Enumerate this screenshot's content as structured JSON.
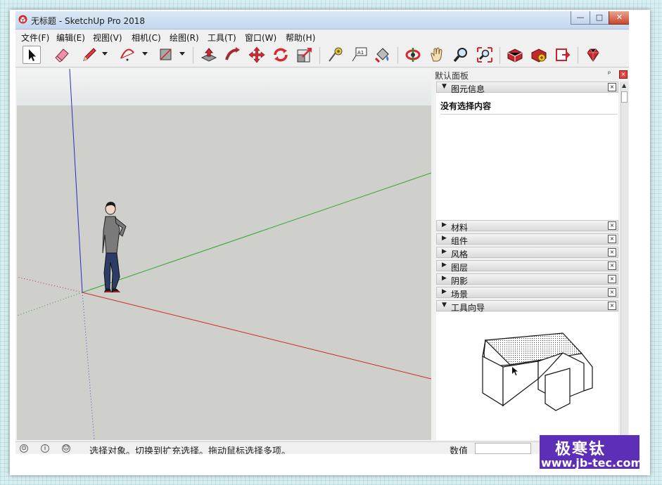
{
  "window": {
    "title": "无标题 - SketchUp Pro 2018",
    "controls": {
      "minimize": "—",
      "maximize": "□",
      "close": "✕"
    }
  },
  "menu": [
    "文件(F)",
    "编辑(E)",
    "视图(V)",
    "相机(C)",
    "绘图(R)",
    "工具(T)",
    "窗口(W)",
    "帮助(H)"
  ],
  "toolbar": {
    "tools": [
      {
        "name": "select-tool-icon"
      },
      {
        "name": "eraser-tool-icon"
      },
      {
        "name": "pencil-line-tool-icon"
      },
      {
        "name": "arc-tool-icon"
      },
      {
        "name": "rectangle-tool-icon"
      },
      {
        "name": "push-pull-tool-icon"
      },
      {
        "name": "follow-me-tool-icon"
      },
      {
        "name": "move-tool-icon"
      },
      {
        "name": "rotate-tool-icon"
      },
      {
        "name": "scale-tool-icon"
      },
      {
        "name": "tape-measure-tool-icon"
      },
      {
        "name": "text-tool-icon"
      },
      {
        "name": "paint-bucket-tool-icon"
      },
      {
        "name": "orbit-tool-icon"
      },
      {
        "name": "pan-tool-icon"
      },
      {
        "name": "zoom-tool-icon"
      },
      {
        "name": "zoom-extents-tool-icon"
      },
      {
        "name": "3d-warehouse-icon"
      },
      {
        "name": "extension-warehouse-icon"
      },
      {
        "name": "layout-send-icon"
      },
      {
        "name": "ruby-console-icon"
      }
    ],
    "text_tool_label": "A1"
  },
  "viewport": {
    "axis_colors": {
      "blue": "#2a2ac8",
      "green": "#2ea82e",
      "red": "#cc2a2a"
    }
  },
  "panel": {
    "title": "默认面板",
    "pin": "ᵖ",
    "close": "×",
    "entity_info": {
      "label": "图元信息",
      "expanded": true,
      "content": "没有选择内容"
    },
    "sections": [
      {
        "label": "材料",
        "expanded": false
      },
      {
        "label": "组件",
        "expanded": false
      },
      {
        "label": "风格",
        "expanded": false
      },
      {
        "label": "图层",
        "expanded": false
      },
      {
        "label": "阴影",
        "expanded": false
      },
      {
        "label": "场景",
        "expanded": false
      },
      {
        "label": "工具向导",
        "expanded": true
      }
    ],
    "arrow_collapsed": "▶",
    "arrow_expanded": "▼",
    "section_close": "×"
  },
  "status": {
    "text": "选择对象。切换到扩充选择。拖动鼠标选择多项。",
    "icons": [
      "geo-location-icon",
      "credits-info-icon",
      "user-account-icon"
    ],
    "icon_glyphs": [
      "⊙",
      "i",
      "☺"
    ],
    "measure_label": "数值",
    "measure_value": ""
  },
  "watermark": {
    "title": "极寒钛",
    "url": "www.jb-tec.com"
  }
}
